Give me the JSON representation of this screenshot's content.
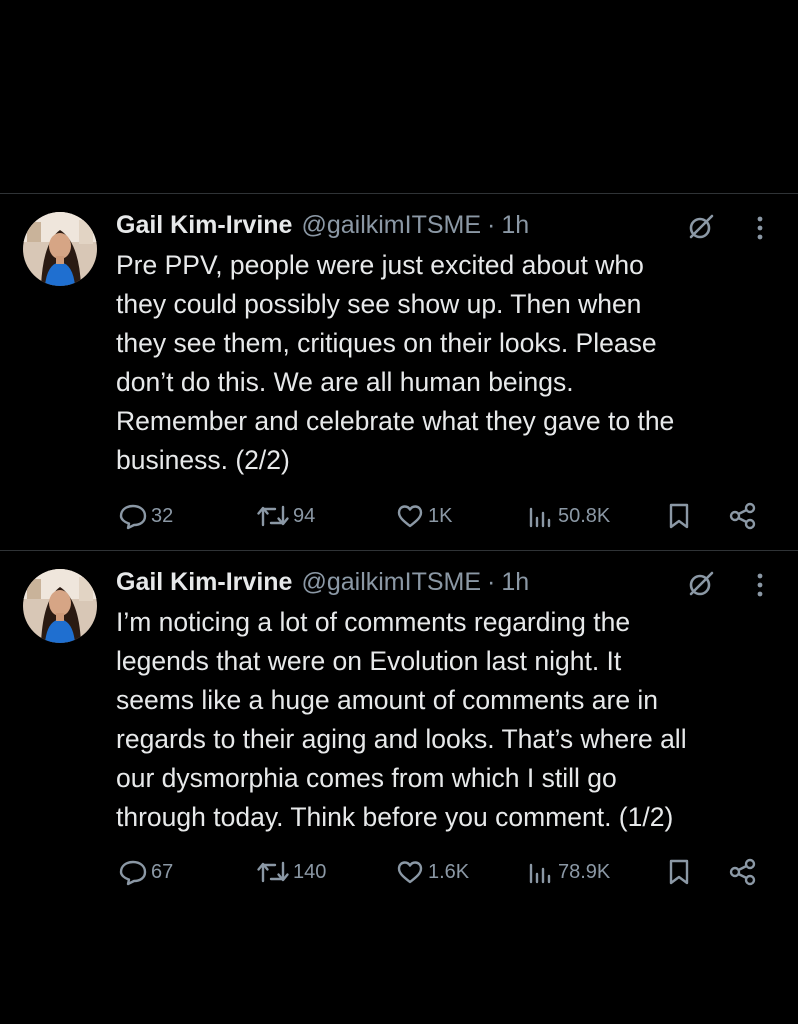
{
  "tweets": [
    {
      "author_name": "Gail Kim-Irvine",
      "handle": "@gailkimITSME",
      "separator": "·",
      "time": "1h",
      "text": "Pre PPV, people were just excited about who\nthey could possibly see show up. Then when\nthey see them, critiques on their looks.  Please\ndon’t do this.  We are all human beings.\nRemember and celebrate what they gave to the\nbusiness. (2/2)",
      "replies": "32",
      "reposts": "94",
      "likes": "1K",
      "views": "50.8K",
      "icons": [
        "grok-icon",
        "more-icon",
        "reply-icon",
        "repost-icon",
        "like-icon",
        "views-icon",
        "bookmark-icon",
        "share-icon"
      ]
    },
    {
      "author_name": "Gail Kim-Irvine",
      "handle": "@gailkimITSME",
      "separator": "·",
      "time": "1h",
      "text": "I’m noticing a lot of comments regarding the\nlegends that were on Evolution last night.  It\nseems like a huge amount of comments are in\nregards to their aging and looks.  That’s where all\nour dysmorphia comes from which I still go\nthrough today.  Think before you comment. (1/2)",
      "replies": "67",
      "reposts": "140",
      "likes": "1.6K",
      "views": "78.9K",
      "icons": [
        "grok-icon",
        "more-icon",
        "reply-icon",
        "repost-icon",
        "like-icon",
        "views-icon",
        "bookmark-icon",
        "share-icon"
      ]
    }
  ],
  "colors": {
    "background": "#000000",
    "primary_text": "#e7e9ea",
    "secondary_text": "#8b98a5",
    "divider": "#2f3336"
  }
}
